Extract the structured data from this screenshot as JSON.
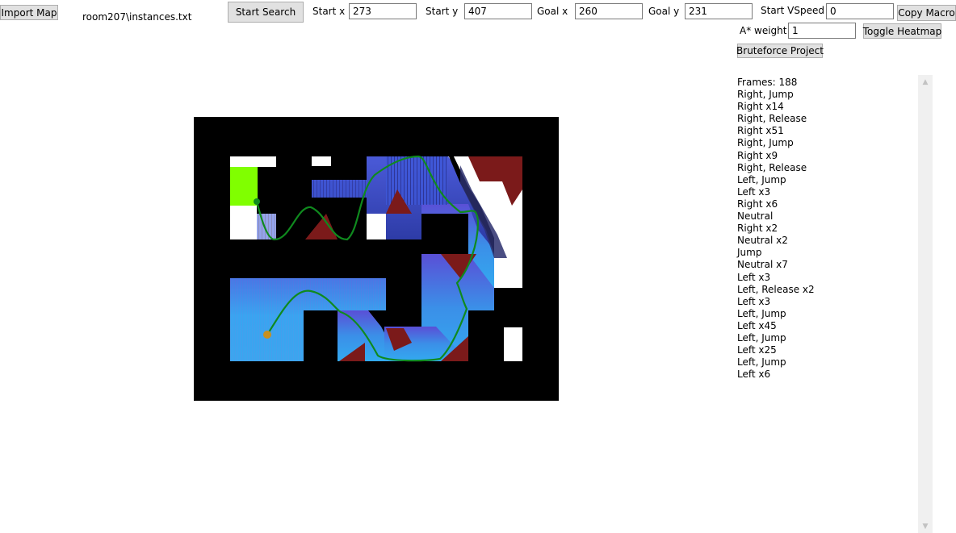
{
  "toolbar": {
    "import_label": "Import Map",
    "file_path": "room207\\instances.txt",
    "start_search_label": "Start Search",
    "start_x_label": "Start x",
    "start_x_value": "273",
    "start_y_label": "Start y",
    "start_y_value": "407",
    "goal_x_label": "Goal x",
    "goal_x_value": "260",
    "goal_y_label": "Goal y",
    "goal_y_value": "231",
    "start_vspeed_label": "Start VSpeed",
    "start_vspeed_value": "0",
    "copy_macro_label": "Copy Macro",
    "astar_weight_label": "A* weight",
    "astar_weight_value": "1",
    "toggle_heatmap_label": "Toggle Heatmap",
    "bruteforce_label": "Bruteforce Project"
  },
  "log": [
    "Frames: 188",
    "Right, Jump",
    "Right x14",
    "Right, Release",
    "Right x51",
    "Right, Jump",
    "Right x9",
    "Right, Release",
    "Left, Jump",
    "Left x3",
    "Right x6",
    "Neutral",
    "Right x2",
    "Neutral x2",
    "Jump",
    "Neutral x7",
    "Left x3",
    "Left, Release x2",
    "Left x3",
    "Left, Jump",
    "Left x45",
    "Left, Jump",
    "Left x25",
    "Left, Jump",
    "Left x6"
  ],
  "map": {
    "colors": {
      "wall": "#000000",
      "open": "#ffffff",
      "spike": "#7b1a1a",
      "goal": "#80ff00",
      "path": "#0f8a1e",
      "start_marker": "#c8901e",
      "end_marker": "#0f8a1e",
      "heat_blue": "#3b5be0",
      "heat_light": "#36a8f0"
    },
    "icons": {
      "scroll_up": "chevron-up-icon",
      "scroll_down": "chevron-down-icon"
    }
  }
}
